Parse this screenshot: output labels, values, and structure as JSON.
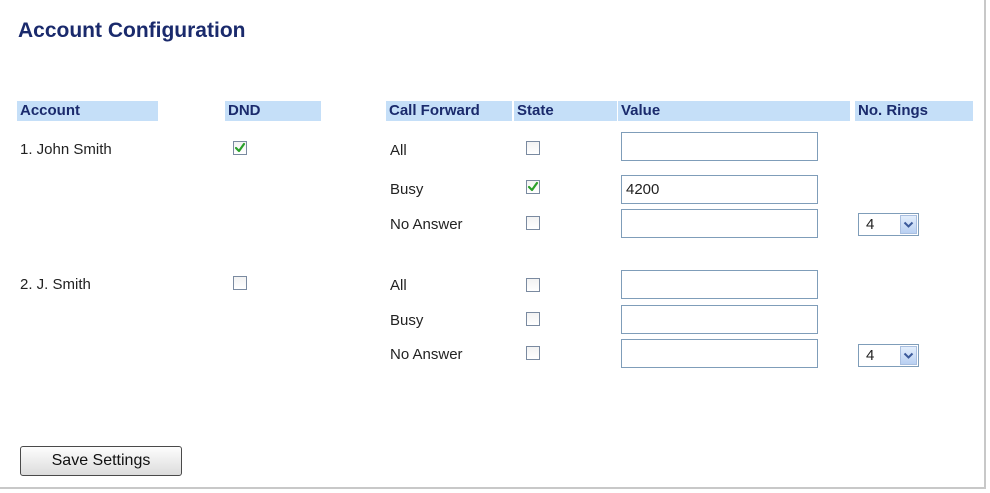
{
  "page": {
    "title": "Account Configuration"
  },
  "headers": {
    "account": "Account",
    "dnd": "DND",
    "call_forward": "Call Forward",
    "state": "State",
    "value": "Value",
    "no_rings": "No. Rings"
  },
  "accounts": [
    {
      "name": "1. John Smith",
      "dnd_checked": true,
      "forwards": [
        {
          "label": "All",
          "state_checked": false,
          "value": ""
        },
        {
          "label": "Busy",
          "state_checked": true,
          "value": "4200"
        },
        {
          "label": "No Answer",
          "state_checked": false,
          "value": "",
          "rings": "4"
        }
      ]
    },
    {
      "name": "2. J. Smith",
      "dnd_checked": false,
      "forwards": [
        {
          "label": "All",
          "state_checked": false,
          "value": ""
        },
        {
          "label": "Busy",
          "state_checked": false,
          "value": ""
        },
        {
          "label": "No Answer",
          "state_checked": false,
          "value": "",
          "rings": "4"
        }
      ]
    }
  ],
  "save_button_label": "Save Settings",
  "colors": {
    "title": "#1a2a6c",
    "header_bg": "#c5dff8",
    "check_mark": "#2aa02a"
  },
  "icons": {
    "checkmark": "check-icon",
    "dropdown": "chevron-down-icon"
  }
}
